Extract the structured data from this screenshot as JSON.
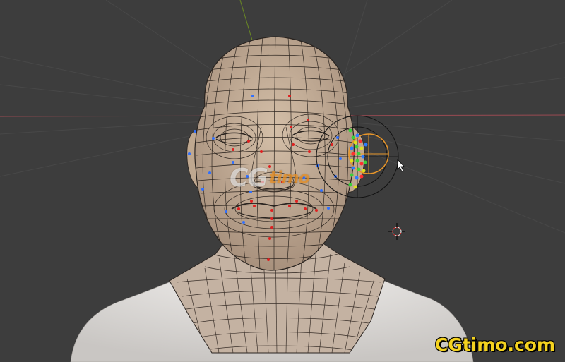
{
  "viewport": {
    "background": "#3d3d3d",
    "mode": "edit-mode-wireframe"
  },
  "colors": {
    "axis_x": "#a04b52",
    "axis_z": "#6b8a24",
    "grid": "#4a4a4a",
    "skin": "#c8b09a",
    "wire": "#2a2420",
    "selection_orange": "#e8962a",
    "joint_red": "#e02020",
    "joint_blue": "#3070ff"
  },
  "icons": {
    "cursor": "mouse-pointer-icon",
    "cursor_3d": "3d-cursor-icon"
  },
  "watermarks": {
    "center_cg": "CG",
    "center_timo": "timo",
    "corner": "CGtimo.com"
  }
}
